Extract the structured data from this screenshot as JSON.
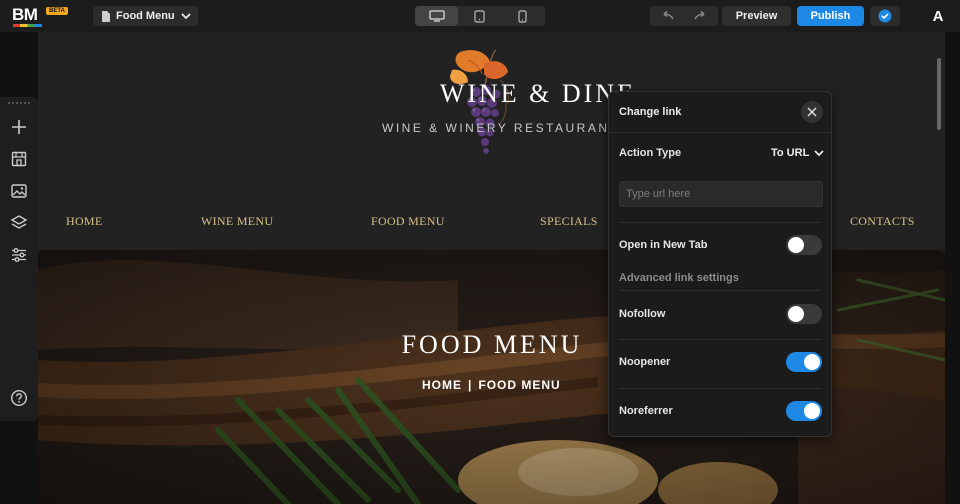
{
  "app": {
    "logo": "BM",
    "badge": "BETA",
    "page_selector": "Food Menu",
    "preview_label": "Preview",
    "publish_label": "Publish",
    "account_initial": "A"
  },
  "site": {
    "brand_title": "WINE & DINE",
    "brand_subtitle": "WINE & WINERY RESTAURANT",
    "nav": [
      "HOME",
      "WINE MENU",
      "FOOD MENU",
      "SPECIALS",
      "CONTACTS"
    ],
    "hero_title": "FOOD MENU",
    "crumbs": [
      "HOME",
      "|",
      "FOOD MENU"
    ]
  },
  "link_panel": {
    "title": "Change link",
    "action_type_label": "Action Type",
    "action_type_value": "To URL",
    "url_placeholder": "Type url here",
    "url_value": "",
    "open_new_tab_label": "Open in New Tab",
    "open_new_tab": false,
    "advanced_title": "Advanced link settings",
    "nofollow_label": "Nofollow",
    "nofollow": false,
    "noopener_label": "Noopener",
    "noopener": true,
    "noreferrer_label": "Noreferrer",
    "noreferrer": true
  },
  "colors": {
    "accent": "#1e88e5",
    "nav_gold": "#d8c08a",
    "panel_bg": "#1b1b1b"
  },
  "icons": [
    "page-icon",
    "chevron-down-icon",
    "desktop-icon",
    "tablet-icon",
    "mobile-icon",
    "undo-icon",
    "redo-icon",
    "check-circle-icon",
    "plus-icon",
    "store-icon",
    "image-icon",
    "layers-icon",
    "sliders-icon",
    "help-icon",
    "close-icon"
  ]
}
